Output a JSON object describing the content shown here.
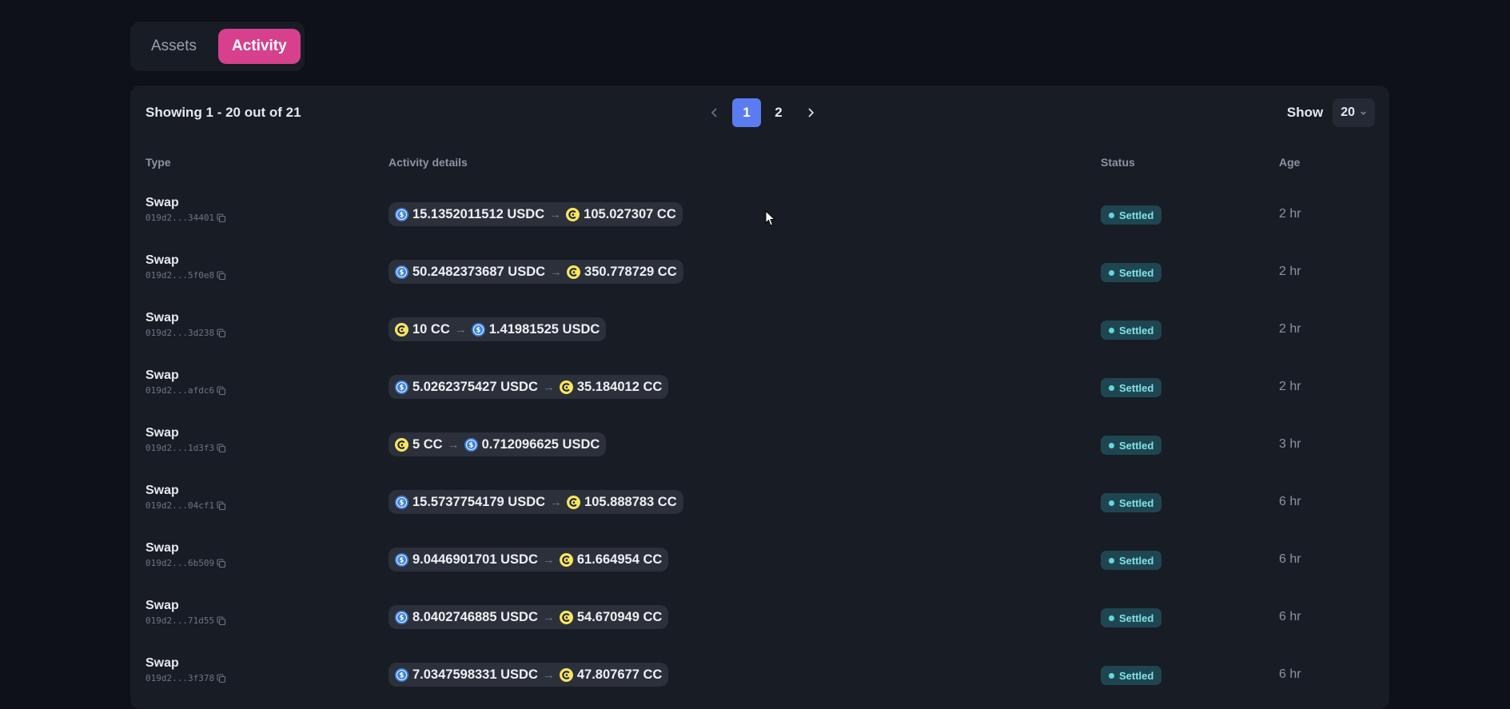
{
  "tabs": [
    {
      "label": "Assets",
      "active": false
    },
    {
      "label": "Activity",
      "active": true
    }
  ],
  "summary": "Showing 1 - 20 out of 21",
  "pagination": {
    "pages": [
      "1",
      "2"
    ],
    "current": "1"
  },
  "show": {
    "label": "Show",
    "value": "20"
  },
  "columns": {
    "type": "Type",
    "details": "Activity details",
    "status": "Status",
    "age": "Age"
  },
  "colors": {
    "accent_pink": "#d6408c",
    "page_blue": "#5b7cf0",
    "settled": "#7fe3ea",
    "usdc": "#3b7fd8",
    "cc": "#f5e663"
  },
  "rows": [
    {
      "type": "Swap",
      "id": "019d2...34401",
      "from_amount": "15.1352011512 USDC",
      "from_coin": "usdc",
      "to_amount": "105.027307 CC",
      "to_coin": "cc",
      "status": "Settled",
      "age": "2 hr"
    },
    {
      "type": "Swap",
      "id": "019d2...5f0e8",
      "from_amount": "50.2482373687 USDC",
      "from_coin": "usdc",
      "to_amount": "350.778729 CC",
      "to_coin": "cc",
      "status": "Settled",
      "age": "2 hr"
    },
    {
      "type": "Swap",
      "id": "019d2...3d238",
      "from_amount": "10 CC",
      "from_coin": "cc",
      "to_amount": "1.41981525 USDC",
      "to_coin": "usdc",
      "status": "Settled",
      "age": "2 hr"
    },
    {
      "type": "Swap",
      "id": "019d2...afdc6",
      "from_amount": "5.0262375427 USDC",
      "from_coin": "usdc",
      "to_amount": "35.184012 CC",
      "to_coin": "cc",
      "status": "Settled",
      "age": "2 hr"
    },
    {
      "type": "Swap",
      "id": "019d2...1d3f3",
      "from_amount": "5 CC",
      "from_coin": "cc",
      "to_amount": "0.712096625 USDC",
      "to_coin": "usdc",
      "status": "Settled",
      "age": "3 hr"
    },
    {
      "type": "Swap",
      "id": "019d2...04cf1",
      "from_amount": "15.5737754179 USDC",
      "from_coin": "usdc",
      "to_amount": "105.888783 CC",
      "to_coin": "cc",
      "status": "Settled",
      "age": "6 hr"
    },
    {
      "type": "Swap",
      "id": "019d2...6b509",
      "from_amount": "9.0446901701 USDC",
      "from_coin": "usdc",
      "to_amount": "61.664954 CC",
      "to_coin": "cc",
      "status": "Settled",
      "age": "6 hr"
    },
    {
      "type": "Swap",
      "id": "019d2...71d55",
      "from_amount": "8.0402746885 USDC",
      "from_coin": "usdc",
      "to_amount": "54.670949 CC",
      "to_coin": "cc",
      "status": "Settled",
      "age": "6 hr"
    },
    {
      "type": "Swap",
      "id": "019d2...3f378",
      "from_amount": "7.0347598331 USDC",
      "from_coin": "usdc",
      "to_amount": "47.807677 CC",
      "to_coin": "cc",
      "status": "Settled",
      "age": "6 hr"
    }
  ]
}
